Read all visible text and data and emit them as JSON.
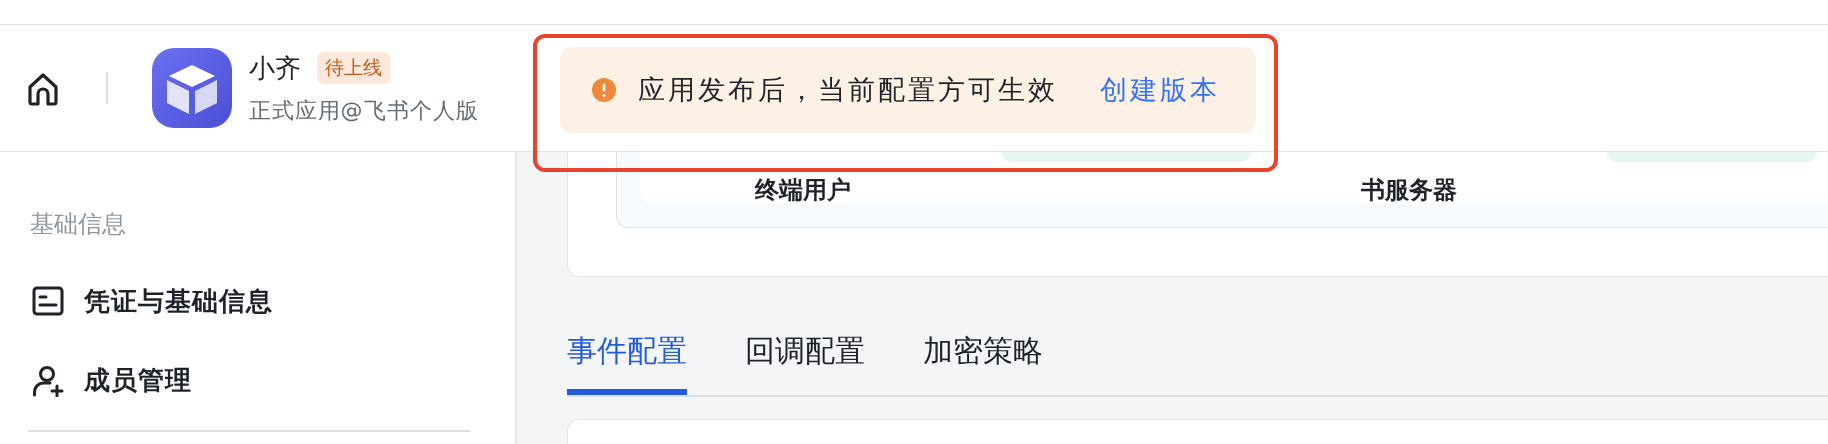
{
  "header": {
    "app_name": "小齐",
    "status_badge": "待上线",
    "subtitle": "正式应用@飞书个人版"
  },
  "notice": {
    "message": "应用发布后，当前配置方可生效",
    "action": "创建版本"
  },
  "diagram": {
    "nodes": [
      "终端用户",
      "书服务器"
    ]
  },
  "sidebar": {
    "section": "基础信息",
    "items": [
      {
        "label": "凭证与基础信息",
        "kind": "card"
      },
      {
        "label": "成员管理",
        "kind": "member"
      }
    ]
  },
  "tabs": [
    {
      "label": "事件配置",
      "selected": true
    },
    {
      "label": "回调配置",
      "selected": false
    },
    {
      "label": "加密策略",
      "selected": false
    }
  ]
}
